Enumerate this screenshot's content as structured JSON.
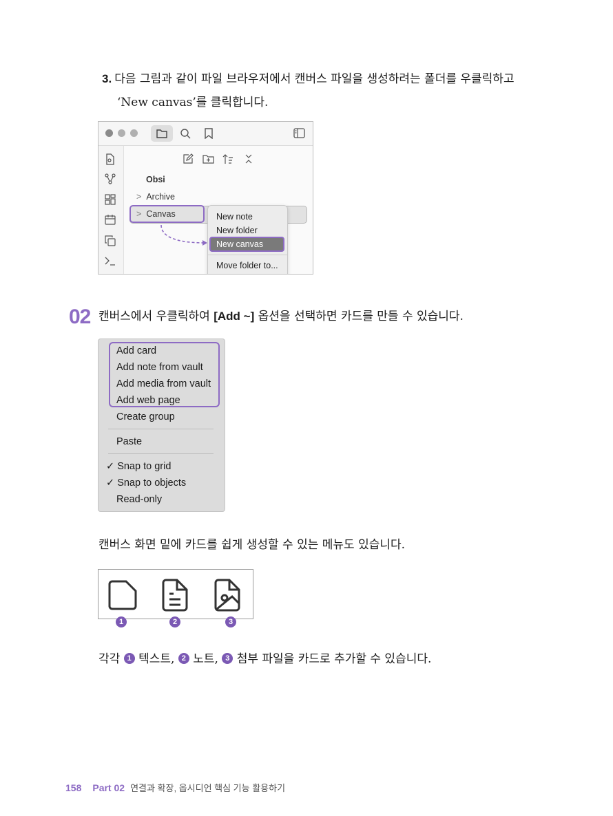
{
  "step": {
    "number": "3.",
    "line1": "다음 그림과 같이 파일 브라우저에서 캔버스 파일을 생성하려는 폴더를 우클릭하고",
    "line2": "‘New canvas’를 클릭합니다."
  },
  "screenshot1": {
    "vault_name": "Obsi",
    "folders": [
      "Archive",
      "Canvas"
    ],
    "context_menu": [
      "New note",
      "New folder",
      "New canvas",
      "Move folder to..."
    ],
    "highlight_color": "#8d6bc4"
  },
  "section": {
    "number": "02",
    "text_before": "캔버스에서 우클릭하여 ",
    "text_bold": "[Add ~]",
    "text_after": " 옵션을 선택하면 카드를 만들 수 있습니다."
  },
  "canvas_menu": {
    "items": [
      "Add card",
      "Add note from vault",
      "Add media from vault",
      "Add web page",
      "Create group",
      "Paste",
      "Snap to grid",
      "Snap to objects",
      "Read-only"
    ],
    "checkmark": "✓"
  },
  "para1": "캔버스 화면 밑에 카드를 쉽게 생성할 수 있는 메뉴도 있습니다.",
  "icon_bar": {
    "badges": [
      "1",
      "2",
      "3"
    ],
    "icons": [
      "text-card-icon",
      "note-card-icon",
      "media-card-icon"
    ]
  },
  "para2": {
    "p0": "각각 ",
    "p1": " 텍스트, ",
    "p2": " 노트, ",
    "p3": " 첨부 파일을 카드로 추가할 수 있습니다."
  },
  "footer": {
    "page": "158",
    "part": "Part 02",
    "title": "연결과 확장, 옵시디언 핵심 기능 활용하기"
  }
}
